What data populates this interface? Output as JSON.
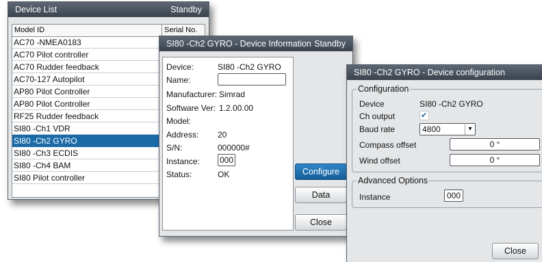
{
  "device_list": {
    "title": "Device List",
    "status": "Standby",
    "columns": [
      "Model ID",
      "Serial No."
    ],
    "rows": [
      "AC70 -NMEA0183",
      "AC70 Pilot controller",
      "AC70 Rudder feedback",
      "AC70-127 Autopilot",
      "AP80 Pilot Controller",
      "AP80 Pilot Controller",
      "RF25 Rudder feedback",
      "SI80 -Ch1 VDR",
      "SI80 -Ch2 GYRO",
      "SI80 -Ch3 ECDIS",
      "SI80 -Ch4 BAM",
      "SI80 Pilot controller"
    ],
    "selected_row": "SI80 -Ch2 GYRO"
  },
  "device_info": {
    "title": "SI80 -Ch2 GYRO - Device Information",
    "status": "Standby",
    "fields": {
      "device_label": "Device:",
      "device_value": "SI80 -Ch2 GYRO",
      "name_label": "Name:",
      "name_value": "",
      "manufacturer_label": "Manufacturer:",
      "manufacturer_value": "Simrad",
      "software_label": "Software Ver:",
      "software_value": "1.2.00.00",
      "model_label": "Model:",
      "model_value": "",
      "address_label": "Address:",
      "address_value": "20",
      "sn_label": "S/N:",
      "sn_value": "000000#",
      "instance_label": "Instance:",
      "instance_value": "000",
      "status_label": "Status:",
      "status_value": "OK"
    },
    "buttons": {
      "configure": "Configure",
      "data": "Data",
      "close": "Close"
    }
  },
  "device_config": {
    "title": "SI80 -Ch2 GYRO - Device configuration",
    "configuration": {
      "legend": "Configuration",
      "device_label": "Device",
      "device_value": "SI80 -Ch2 GYRO",
      "ch_output_label": "Ch output",
      "ch_output_checked": true,
      "check_glyph": "✔",
      "baud_label": "Baud rate",
      "baud_value": "4800",
      "dropdown_glyph": "▾",
      "compass_label": "Compass offset",
      "compass_value": "0 °",
      "wind_label": "Wind offset",
      "wind_value": "0 °"
    },
    "advanced": {
      "legend": "Advanced Options",
      "instance_label": "Instance",
      "instance_value": "000"
    },
    "close_button": "Close"
  },
  "colors": {
    "titlebar": "#4a535d",
    "selected": "#1a6ba8",
    "active_button": "#1f72b4"
  }
}
